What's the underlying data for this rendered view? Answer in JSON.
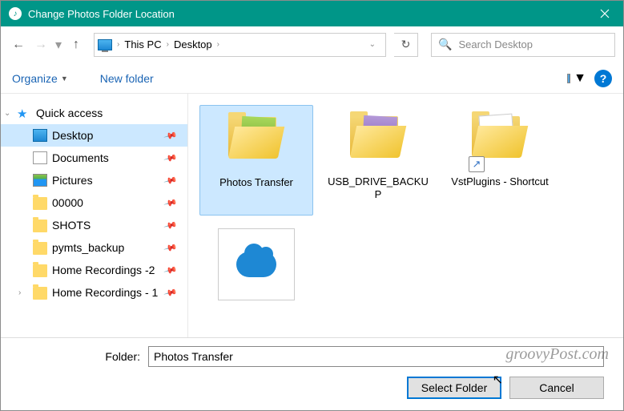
{
  "window": {
    "title": "Change Photos Folder Location"
  },
  "breadcrumb": {
    "root": "This PC",
    "leaf": "Desktop"
  },
  "search": {
    "placeholder": "Search Desktop"
  },
  "toolbar": {
    "organize": "Organize",
    "new_folder": "New folder"
  },
  "sidebar": {
    "quick_access": "Quick access",
    "items": [
      {
        "label": "Desktop",
        "pinned": true,
        "selected": true,
        "icon": "desk"
      },
      {
        "label": "Documents",
        "pinned": true,
        "icon": "doc"
      },
      {
        "label": "Pictures",
        "pinned": true,
        "icon": "pic"
      },
      {
        "label": "00000",
        "pinned": true,
        "icon": "folder"
      },
      {
        "label": "SHOTS",
        "pinned": true,
        "icon": "folder"
      },
      {
        "label": "pymts_backup",
        "pinned": true,
        "icon": "folder"
      },
      {
        "label": "Home Recordings -2",
        "pinned": true,
        "icon": "folder"
      },
      {
        "label": "Home Recordings - 1",
        "pinned": true,
        "icon": "folder"
      }
    ]
  },
  "content": {
    "items": [
      {
        "label": "Photos Transfer",
        "selected": true,
        "type": "folder-photos"
      },
      {
        "label": "USB_DRIVE_BACKUP",
        "type": "folder-usb"
      },
      {
        "label": "VstPlugins - Shortcut",
        "type": "folder-shortcut"
      },
      {
        "label": "",
        "type": "onedrive"
      }
    ]
  },
  "footer": {
    "folder_label": "Folder:",
    "folder_value": "Photos Transfer",
    "select": "Select Folder",
    "cancel": "Cancel"
  },
  "watermark": "groovyPost.com"
}
